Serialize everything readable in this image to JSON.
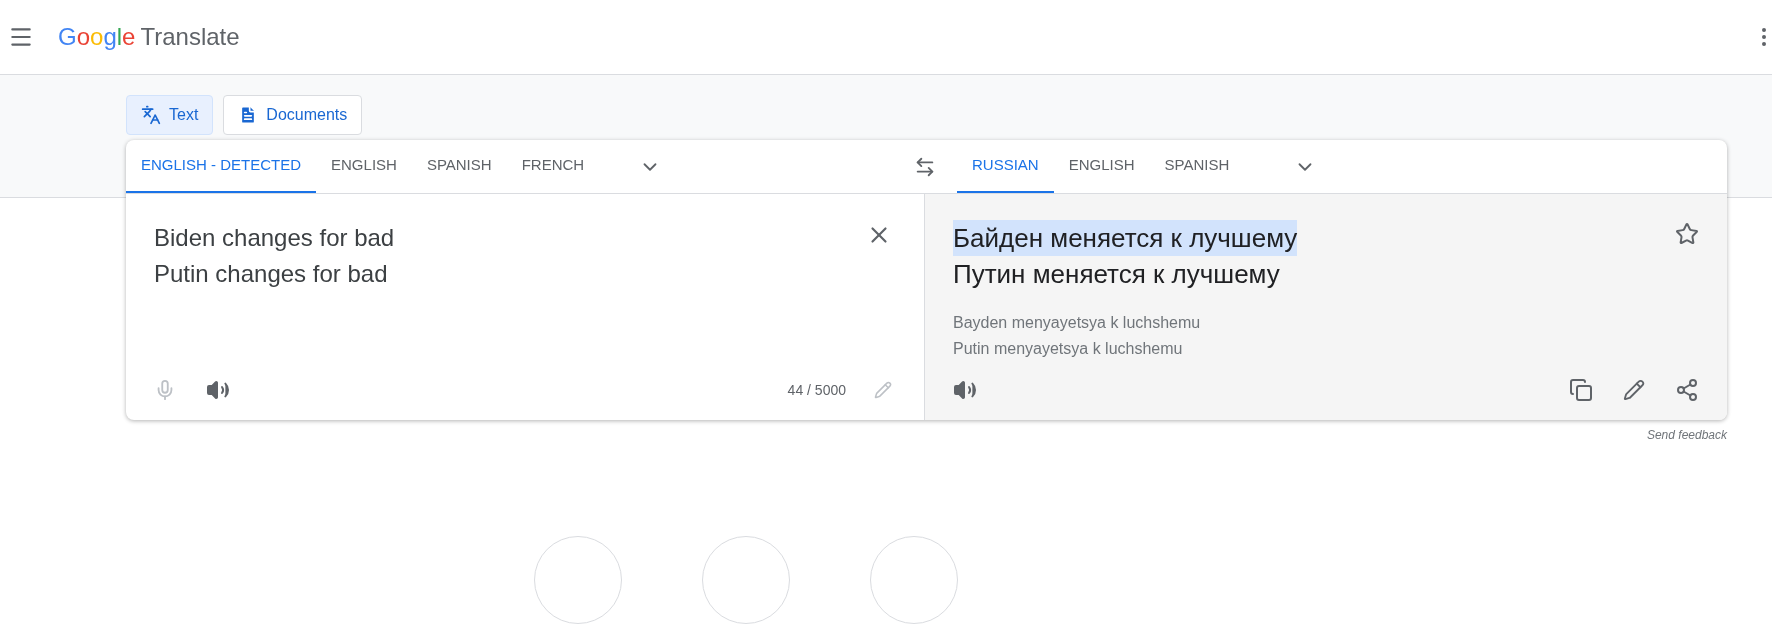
{
  "header": {
    "logo": "Google",
    "title": "Translate"
  },
  "modes": [
    {
      "label": "Text",
      "kind": "text",
      "selected": true
    },
    {
      "label": "Documents",
      "kind": "documents",
      "selected": false
    }
  ],
  "source_languages": [
    {
      "label": "ENGLISH - DETECTED",
      "selected": true
    },
    {
      "label": "ENGLISH",
      "selected": false
    },
    {
      "label": "SPANISH",
      "selected": false
    },
    {
      "label": "FRENCH",
      "selected": false
    }
  ],
  "target_languages": [
    {
      "label": "RUSSIAN",
      "selected": true
    },
    {
      "label": "ENGLISH",
      "selected": false
    },
    {
      "label": "SPANISH",
      "selected": false
    }
  ],
  "source": {
    "lines": [
      "Biden changes for bad",
      "Putin changes for bad"
    ],
    "char_count": "44 / 5000",
    "mic_disabled": true
  },
  "target": {
    "lines": [
      {
        "text": "Байден меняется к лучшему",
        "highlighted": true
      },
      {
        "text": "Путин меняется к лучшему",
        "highlighted": false
      }
    ],
    "transliteration": [
      "Bayden menyayetsya k luchshemu",
      "Putin menyayetsya k luchshemu"
    ]
  },
  "feedback_link": "Send feedback"
}
